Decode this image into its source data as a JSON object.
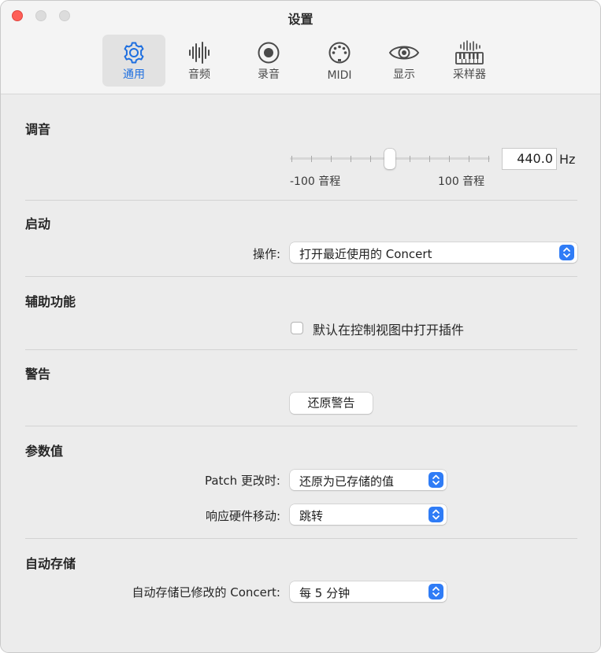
{
  "window": {
    "title": "设置"
  },
  "tabs": [
    {
      "label": "通用",
      "icon": "gear-icon",
      "active": true
    },
    {
      "label": "音频",
      "icon": "waveform-icon",
      "active": false
    },
    {
      "label": "录音",
      "icon": "record-icon",
      "active": false
    },
    {
      "label": "MIDI",
      "icon": "midi-port-icon",
      "active": false
    },
    {
      "label": "显示",
      "icon": "eye-icon",
      "active": false
    },
    {
      "label": "采样器",
      "icon": "sampler-keyboard-icon",
      "active": false
    }
  ],
  "tuning": {
    "title": "调音",
    "value": "440.0",
    "unit": "Hz",
    "min_label": "-100 音程",
    "max_label": "100 音程",
    "slider_fraction": 0.5
  },
  "startup": {
    "title": "启动",
    "action_label": "操作:",
    "action_value": "打开最近使用的 Concert"
  },
  "accessibility": {
    "title": "辅助功能",
    "checkbox_label": "默认在控制视图中打开插件",
    "checked": false
  },
  "warnings": {
    "title": "警告",
    "reset_button": "还原警告"
  },
  "parameters": {
    "title": "参数值",
    "patch_label": "Patch 更改时:",
    "patch_value": "还原为已存储的值",
    "hardware_label": "响应硬件移动:",
    "hardware_value": "跳转"
  },
  "autosave": {
    "title": "自动存储",
    "label": "自动存储已修改的 Concert:",
    "value": "每 5 分钟"
  },
  "colors": {
    "accent": "#1e6fe0",
    "stepper": "#2f7cf6",
    "close": "#fe5f57"
  }
}
